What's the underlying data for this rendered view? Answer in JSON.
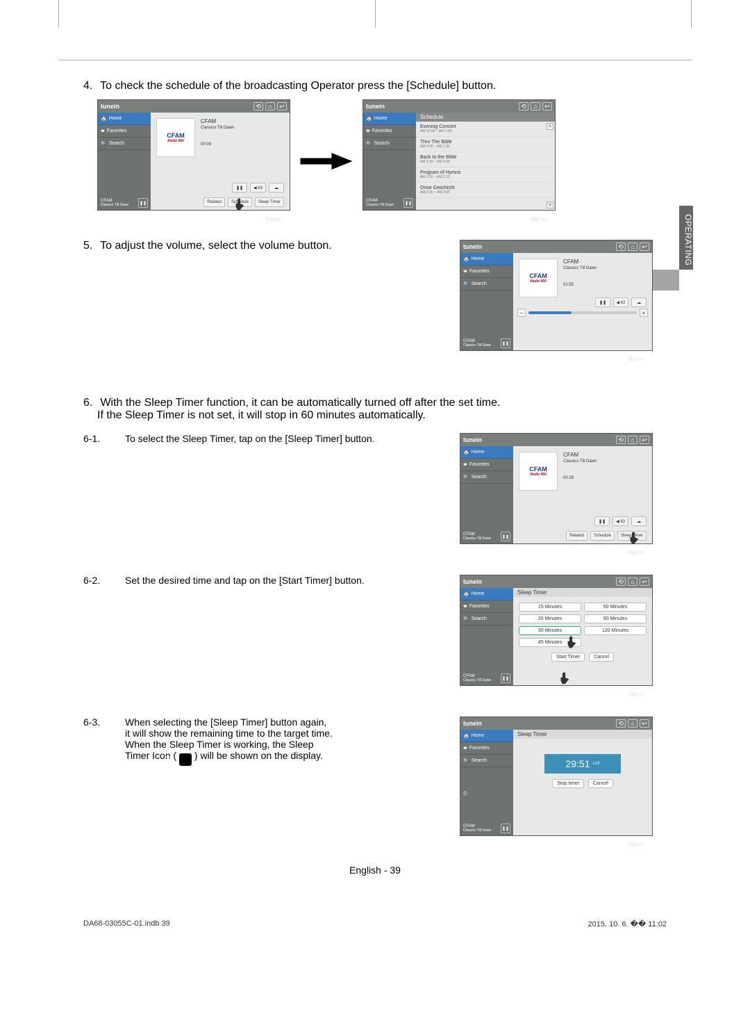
{
  "section_tab": "OPERATING",
  "steps": {
    "s4": {
      "num": "4.",
      "text": "To check the schedule of the broadcasting Operator press the [Schedule] button."
    },
    "s5": {
      "num": "5.",
      "text": "To adjust the volume, select the volume button."
    },
    "s6": {
      "num": "6.",
      "text1": "With the Sleep Timer function, it can be automatically turned off after the set time.",
      "text2": "If the Sleep Timer is not set, it will stop in 60 minutes automatically."
    },
    "s6_1": {
      "num": "6-1.",
      "text": "To select the Sleep Timer, tap on the [Sleep Timer] button."
    },
    "s6_2": {
      "num": "6-2.",
      "text": "Set the desired time and tap on the [Start Timer] button."
    },
    "s6_3": {
      "num": "6-3.",
      "l1": "When selecting the [Sleep Timer] button again,",
      "l2": "it will show the remaining time to the target time.",
      "l3": "When the Sleep Timer is working, the Sleep",
      "l4a": "Timer Icon ( ",
      "l4b": " ) will be shown on the display."
    }
  },
  "tunein": {
    "brand": "tunein",
    "side": {
      "home": "Home",
      "favorites": "Favorites",
      "search": "Search",
      "station": "CFAM",
      "program": "Classics Till Dawn"
    },
    "logo": {
      "name": "CFAM",
      "sub": "Radio 950"
    },
    "player": {
      "station": "CFAM",
      "program": "Classics Till Dawn",
      "time1": "00:09",
      "time2": "01:55",
      "time3": "00:28",
      "vol1": "◀ 63",
      "vol2": "◀ 62",
      "btn_related": "Related",
      "btn_schedule": "Schedule",
      "btn_sleep": "Sleep Timer",
      "pause": "❚❚"
    },
    "schedule": {
      "header": "Schedule",
      "items": [
        {
          "name": "Evening Concert",
          "time": "AM 12:00 ~ AM 1:00"
        },
        {
          "name": "Thru The Bible",
          "time": "AM 1:00 ~ AM 1:30"
        },
        {
          "name": "Back to the Bible",
          "time": "AM 1:30 ~ AM 2:00"
        },
        {
          "name": "Program of Hymns",
          "time": "AM 2:00 ~ AM 2:15"
        },
        {
          "name": "Onse Geschicht",
          "time": "AM 2:30 ~ AM 3:00"
        }
      ]
    },
    "sleep": {
      "header": "Sleep Timer",
      "opts": [
        "15 Minutes",
        "60 Minutes",
        "20 Minutes",
        "90 Minutes",
        "30 Minutes",
        "120 Minutes",
        "45 Minutes"
      ],
      "start": "Start Timer",
      "cancel": "Cancel",
      "stop": "Stop timer",
      "remaining": "29:51",
      "remaining_unit": "Left"
    },
    "signin": "Sign In",
    "icons": {
      "i1": "⟲",
      "i2": "⌂",
      "i3": "↩"
    }
  },
  "footer": {
    "lang": "English - ",
    "page": "39"
  },
  "print": {
    "left": "DA68-03055C-01.indb   39",
    "right": "2015. 10. 6.   �� 11:02"
  }
}
